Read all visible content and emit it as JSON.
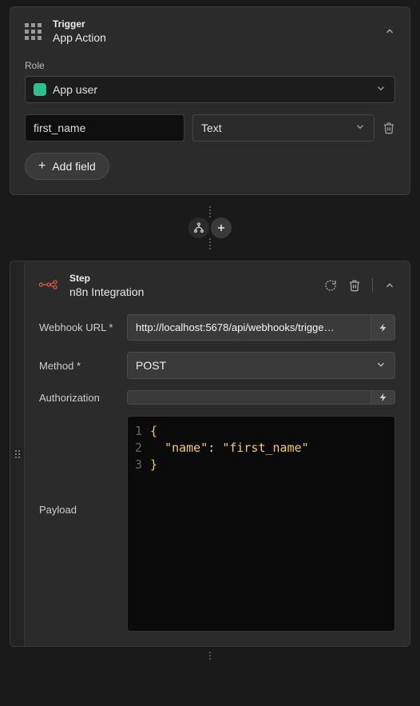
{
  "trigger": {
    "section_label": "Trigger",
    "title": "App Action",
    "role_label": "Role",
    "role_value": "App user",
    "field_name": "first_name",
    "field_type": "Text",
    "add_field_label": "Add field"
  },
  "step": {
    "section_label": "Step",
    "title": "n8n Integration",
    "webhook_label": "Webhook URL *",
    "webhook_value": "http://localhost:5678/api/webhooks/trigge…",
    "method_label": "Method *",
    "method_value": "POST",
    "auth_label": "Authorization",
    "auth_value": "",
    "payload_label": "Payload",
    "code": {
      "l1": "{",
      "l2_key": "\"name\"",
      "l2_colon": ": ",
      "l2_val": "\"first_name\"",
      "l3": "}"
    }
  }
}
